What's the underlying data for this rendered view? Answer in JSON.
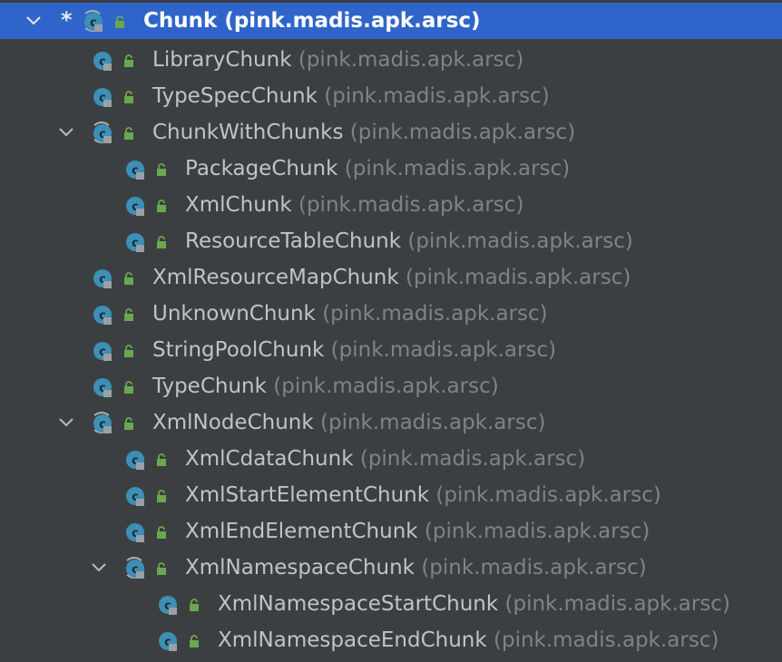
{
  "tree": {
    "root": {
      "name": "Chunk",
      "package": "(pink.madis.apk.arsc)",
      "marker": "*",
      "selected": true
    },
    "items": [
      {
        "name": "LibraryChunk",
        "package": "(pink.madis.apk.arsc)"
      },
      {
        "name": "TypeSpecChunk",
        "package": "(pink.madis.apk.arsc)"
      },
      {
        "name": "ChunkWithChunks",
        "package": "(pink.madis.apk.arsc)"
      },
      {
        "name": "PackageChunk",
        "package": "(pink.madis.apk.arsc)"
      },
      {
        "name": "XmlChunk",
        "package": "(pink.madis.apk.arsc)"
      },
      {
        "name": "ResourceTableChunk",
        "package": "(pink.madis.apk.arsc)"
      },
      {
        "name": "XmlResourceMapChunk",
        "package": "(pink.madis.apk.arsc)"
      },
      {
        "name": "UnknownChunk",
        "package": "(pink.madis.apk.arsc)"
      },
      {
        "name": "StringPoolChunk",
        "package": "(pink.madis.apk.arsc)"
      },
      {
        "name": "TypeChunk",
        "package": "(pink.madis.apk.arsc)"
      },
      {
        "name": "XmlNodeChunk",
        "package": "(pink.madis.apk.arsc)"
      },
      {
        "name": "XmlCdataChunk",
        "package": "(pink.madis.apk.arsc)"
      },
      {
        "name": "XmlStartElementChunk",
        "package": "(pink.madis.apk.arsc)"
      },
      {
        "name": "XmlEndElementChunk",
        "package": "(pink.madis.apk.arsc)"
      },
      {
        "name": "XmlNamespaceChunk",
        "package": "(pink.madis.apk.arsc)"
      },
      {
        "name": "XmlNamespaceStartChunk",
        "package": "(pink.madis.apk.arsc)"
      },
      {
        "name": "XmlNamespaceEndChunk",
        "package": "(pink.madis.apk.arsc)"
      }
    ]
  },
  "icons": {
    "expand": "chevron-down-icon",
    "class": "class-icon",
    "abstract_class": "abstract-class-icon",
    "lock": "lock-icon"
  },
  "colors": {
    "background": "#3c3f41",
    "selection": "#2f65ca",
    "class_icon": "#3d8fb5",
    "lock_icon": "#6aa84f",
    "name_text": "#bfc4c8",
    "package_text": "#7f8387"
  }
}
